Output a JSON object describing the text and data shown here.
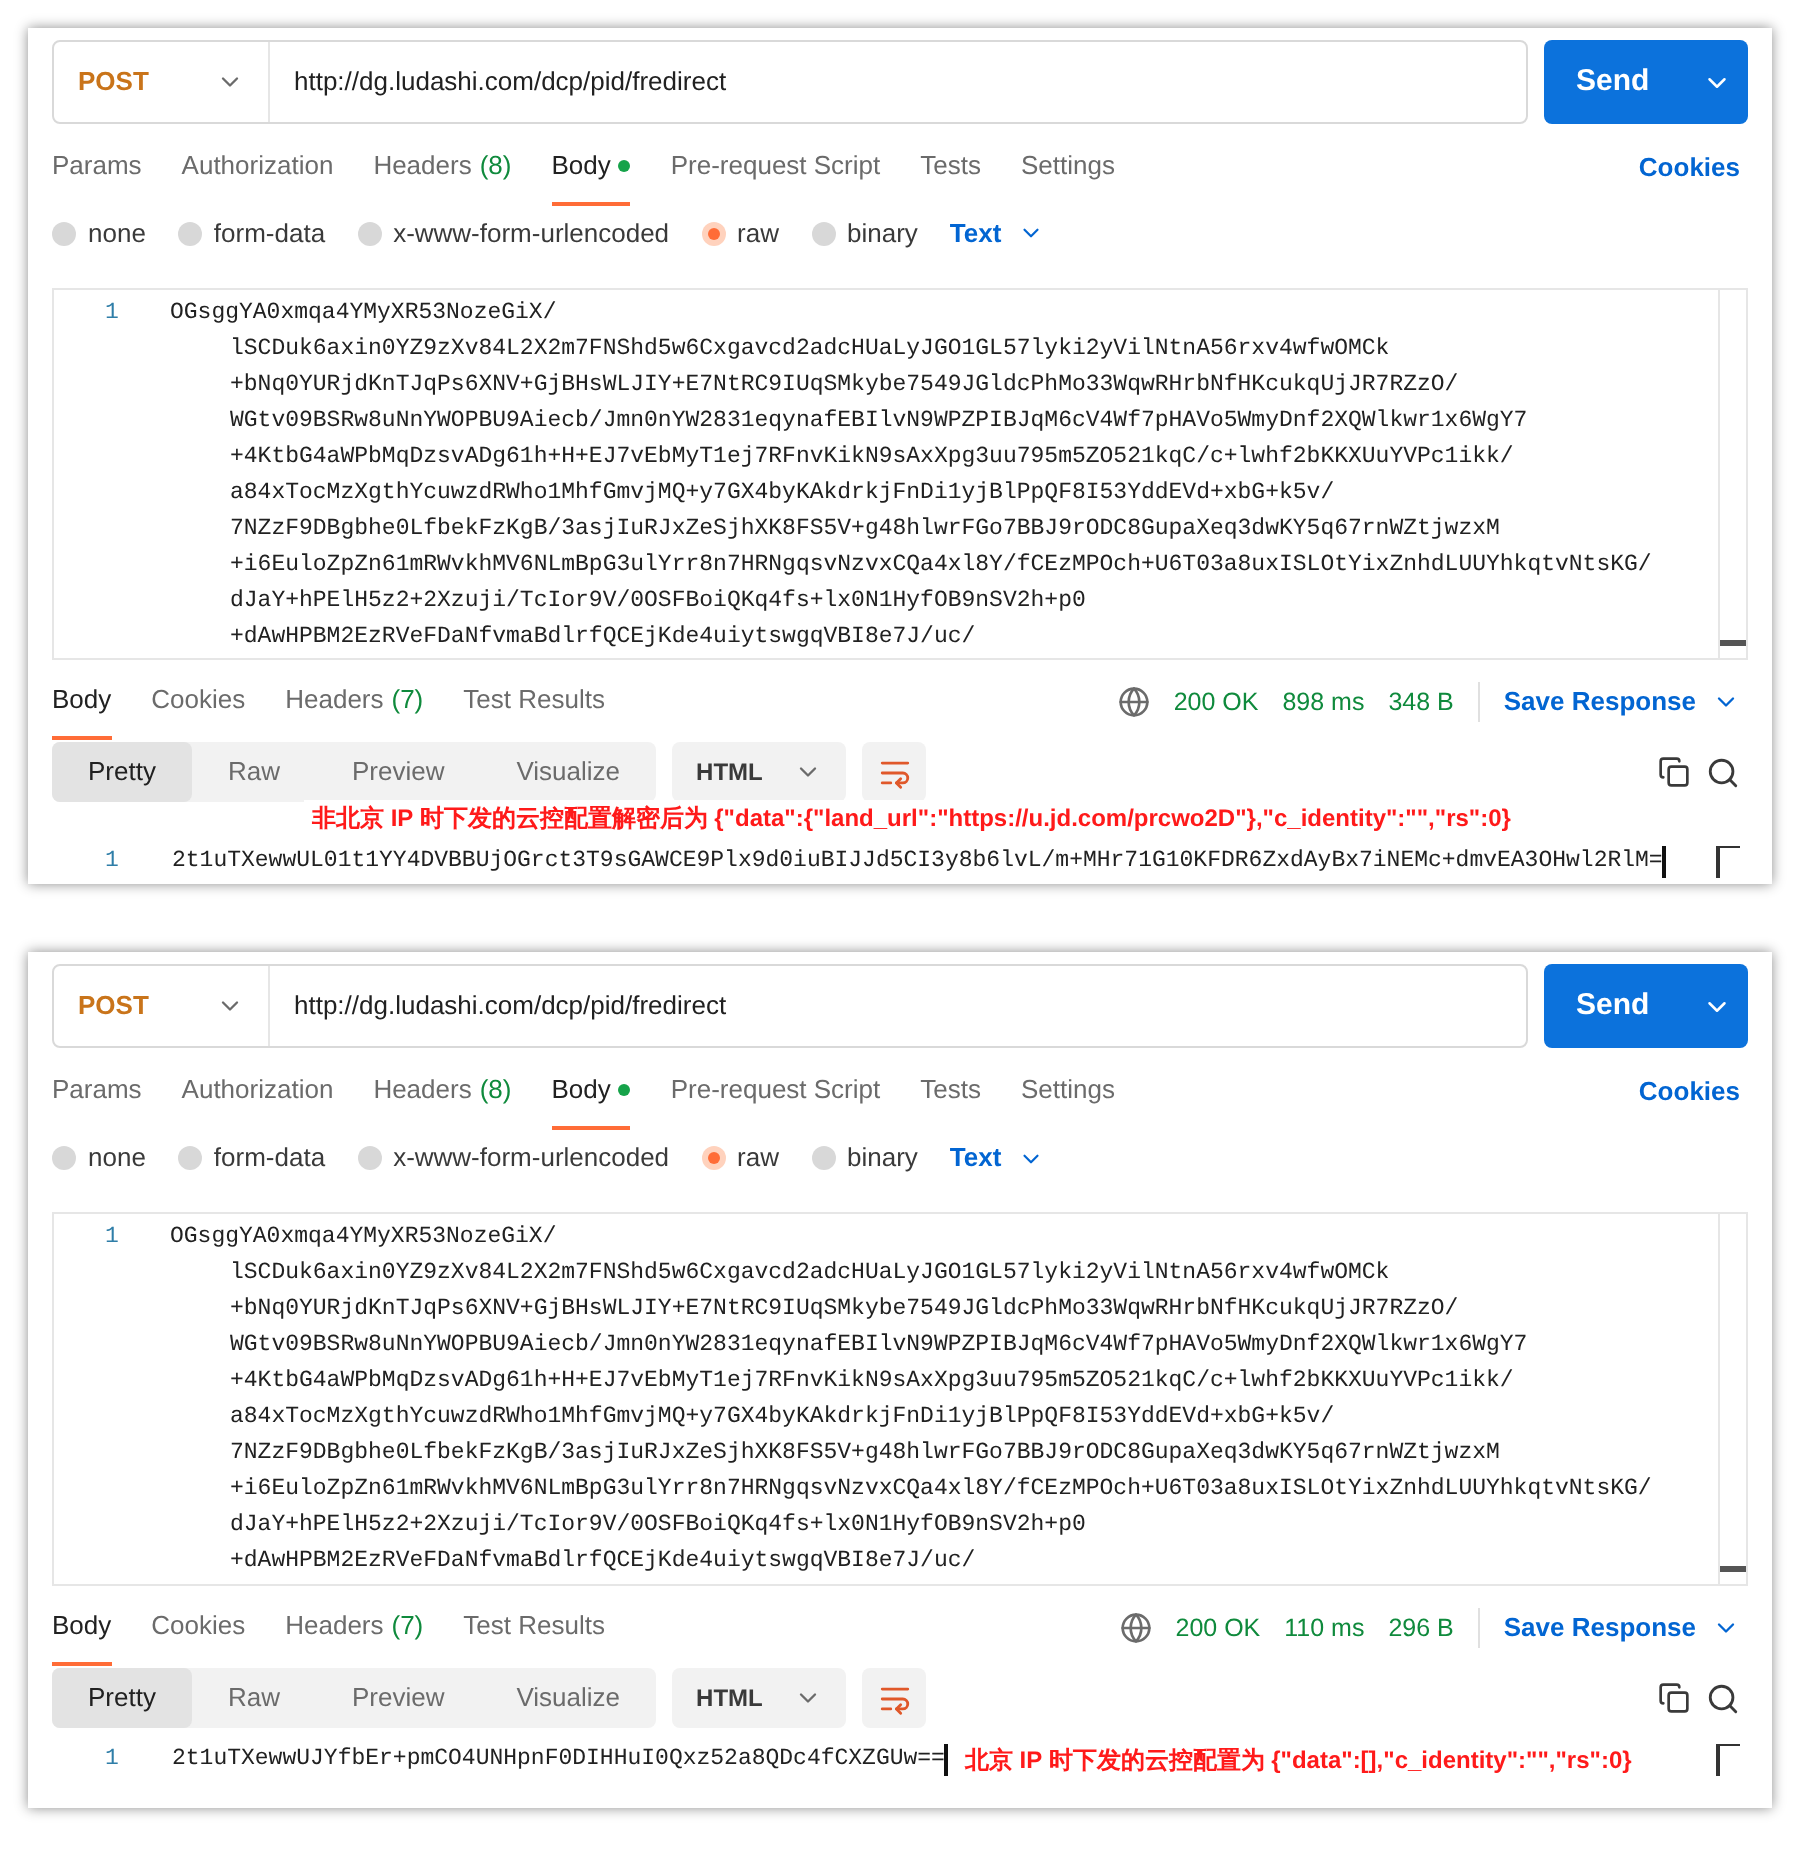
{
  "panels": [
    {
      "request": {
        "method": "POST",
        "url": "http://dg.ludashi.com/dcp/pid/fredirect",
        "send": "Send"
      },
      "request_tabs": [
        {
          "label": "Params",
          "selected": false,
          "has_content": false
        },
        {
          "label": "Authorization",
          "selected": false,
          "has_content": false
        },
        {
          "label": "Headers",
          "count": "(8)",
          "selected": false,
          "has_content": false
        },
        {
          "label": "Body",
          "selected": true,
          "has_content": true
        },
        {
          "label": "Pre-request Script",
          "selected": false,
          "has_content": false
        },
        {
          "label": "Tests",
          "selected": false,
          "has_content": false
        },
        {
          "label": "Settings",
          "selected": false,
          "has_content": false
        }
      ],
      "cookies": "Cookies",
      "body_modes": [
        {
          "label": "none",
          "selected": false
        },
        {
          "label": "form-data",
          "selected": false
        },
        {
          "label": "x-www-form-urlencoded",
          "selected": false
        },
        {
          "label": "raw",
          "selected": true
        },
        {
          "label": "binary",
          "selected": false
        }
      ],
      "body_format": "Text",
      "body_editor": {
        "line_number": "1",
        "segments": [
          "OGsggYA0xmqa4YMyXR53NozeGiX/",
          "lSCDuk6axin0YZ9zXv84L2X2m7FNShd5w6Cxgavcd2adcHUaLyJGO1GL57lyki2yVilNtnA56rxv4wfwOMCk",
          "+bNq0YURjdKnTJqPs6XNV+GjBHsWLJIY+E7NtRC9IUqSMkybe7549JGldcPhMo33WqwRHrbNfHKcukqUjJR7RZzO/",
          "WGtv09BSRw8uNnYWOPBU9Aiecb/Jmn0nYW2831eqynafEBIlvN9WPZPIBJqM6cV4Wf7pHAVo5WmyDnf2XQWlkwr1x6WgY7",
          "+4KtbG4aWPbMqDzsvADg61h+H+EJ7vEbMyT1ej7RFnvKikN9sAxXpg3uu795m5ZO521kqC/c+lwhf2bKKXUuYVPc1ikk/",
          "a84xTocMzXgthYcuwzdRWho1MhfGmvjMQ+y7GX4byKAkdrkjFnDi1yjBlPpQF8I53YddEVd+xbG+k5v/",
          "7NZzF9DBgbhe0LfbekFzKgB/3asjIuRJxZeSjhXK8FS5V+g48hlwrFGo7BBJ9rODC8GupaXeq3dwKY5q67rnWZtjwzxM",
          "+i6EuloZpZn61mRWvkhMV6NLmBpG3ulYrr8n7HRNgqsvNzvxCQa4xl8Y/fCEzMPOch+U6T03a8uxISLOtYixZnhdLUUYhkqtvNtsKG/",
          "dJaY+hPElH5z2+2Xzuji/TcIor9V/0OSFBoiQKq4fs+lx0N1HyfOB9nSV2h+p0",
          "+dAwHPBM2EzRVeFDaNfvmaBdlrfQCEjKde4uiytswgqVBI8e7J/uc/"
        ]
      },
      "response_tabs": [
        {
          "label": "Body",
          "selected": true
        },
        {
          "label": "Cookies",
          "selected": false
        },
        {
          "label": "Headers",
          "count": "(7)",
          "selected": false
        },
        {
          "label": "Test Results",
          "selected": false
        }
      ],
      "status": {
        "code": "200 OK",
        "time": "898 ms",
        "size": "348 B"
      },
      "save_response": "Save Response",
      "view_modes": [
        {
          "label": "Pretty",
          "selected": true
        },
        {
          "label": "Raw",
          "selected": false
        },
        {
          "label": "Preview",
          "selected": false
        },
        {
          "label": "Visualize",
          "selected": false
        }
      ],
      "language": "HTML",
      "response_line": {
        "line_number": "1",
        "text": "2t1uTXewwUL01t1YY4DVBBUjOGrct3T9sGAWCE9Plx9d0iuBIJJd5CI3y8b6lvL/m+MHr71G10KFDR6ZxdAyBx7iNEMc+dmvEA3OHwl2RlM="
      },
      "annotation": {
        "text": "非北京 IP 时下发的云控配置解密后为 {\"data\":{\"land_url\":\"https://u.jd.com/prcwo2D\"},\"c_identity\":\"\",\"rs\":0}",
        "kind": "caption"
      }
    },
    {
      "request": {
        "method": "POST",
        "url": "http://dg.ludashi.com/dcp/pid/fredirect",
        "send": "Send"
      },
      "request_tabs": [
        {
          "label": "Params",
          "selected": false,
          "has_content": false
        },
        {
          "label": "Authorization",
          "selected": false,
          "has_content": false
        },
        {
          "label": "Headers",
          "count": "(8)",
          "selected": false,
          "has_content": false
        },
        {
          "label": "Body",
          "selected": true,
          "has_content": true
        },
        {
          "label": "Pre-request Script",
          "selected": false,
          "has_content": false
        },
        {
          "label": "Tests",
          "selected": false,
          "has_content": false
        },
        {
          "label": "Settings",
          "selected": false,
          "has_content": false
        }
      ],
      "cookies": "Cookies",
      "body_modes": [
        {
          "label": "none",
          "selected": false
        },
        {
          "label": "form-data",
          "selected": false
        },
        {
          "label": "x-www-form-urlencoded",
          "selected": false
        },
        {
          "label": "raw",
          "selected": true
        },
        {
          "label": "binary",
          "selected": false
        }
      ],
      "body_format": "Text",
      "body_editor": {
        "line_number": "1",
        "segments": [
          "OGsggYA0xmqa4YMyXR53NozeGiX/",
          "lSCDuk6axin0YZ9zXv84L2X2m7FNShd5w6Cxgavcd2adcHUaLyJGO1GL57lyki2yVilNtnA56rxv4wfwOMCk",
          "+bNq0YURjdKnTJqPs6XNV+GjBHsWLJIY+E7NtRC9IUqSMkybe7549JGldcPhMo33WqwRHrbNfHKcukqUjJR7RZzO/",
          "WGtv09BSRw8uNnYWOPBU9Aiecb/Jmn0nYW2831eqynafEBIlvN9WPZPIBJqM6cV4Wf7pHAVo5WmyDnf2XQWlkwr1x6WgY7",
          "+4KtbG4aWPbMqDzsvADg61h+H+EJ7vEbMyT1ej7RFnvKikN9sAxXpg3uu795m5ZO521kqC/c+lwhf2bKKXUuYVPc1ikk/",
          "a84xTocMzXgthYcuwzdRWho1MhfGmvjMQ+y7GX4byKAkdrkjFnDi1yjBlPpQF8I53YddEVd+xbG+k5v/",
          "7NZzF9DBgbhe0LfbekFzKgB/3asjIuRJxZeSjhXK8FS5V+g48hlwrFGo7BBJ9rODC8GupaXeq3dwKY5q67rnWZtjwzxM",
          "+i6EuloZpZn61mRWvkhMV6NLmBpG3ulYrr8n7HRNgqsvNzvxCQa4xl8Y/fCEzMPOch+U6T03a8uxISLOtYixZnhdLUUYhkqtvNtsKG/",
          "dJaY+hPElH5z2+2Xzuji/TcIor9V/0OSFBoiQKq4fs+lx0N1HyfOB9nSV2h+p0",
          "+dAwHPBM2EzRVeFDaNfvmaBdlrfQCEjKde4uiytswgqVBI8e7J/uc/"
        ]
      },
      "response_tabs": [
        {
          "label": "Body",
          "selected": true
        },
        {
          "label": "Cookies",
          "selected": false
        },
        {
          "label": "Headers",
          "count": "(7)",
          "selected": false
        },
        {
          "label": "Test Results",
          "selected": false
        }
      ],
      "status": {
        "code": "200 OK",
        "time": "110 ms",
        "size": "296 B"
      },
      "save_response": "Save Response",
      "view_modes": [
        {
          "label": "Pretty",
          "selected": true
        },
        {
          "label": "Raw",
          "selected": false
        },
        {
          "label": "Preview",
          "selected": false
        },
        {
          "label": "Visualize",
          "selected": false
        }
      ],
      "language": "HTML",
      "response_line": {
        "line_number": "1",
        "text": "2t1uTXewwUJYfbEr+pmCO4UNHpnF0DIHHuI0Qxz52a8QDc4fCXZGUw=="
      },
      "annotation": {
        "text": "北京 IP 时下发的云控配置为 {\"data\":[],\"c_identity\":\"\",\"rs\":0}",
        "kind": "inline"
      }
    }
  ]
}
